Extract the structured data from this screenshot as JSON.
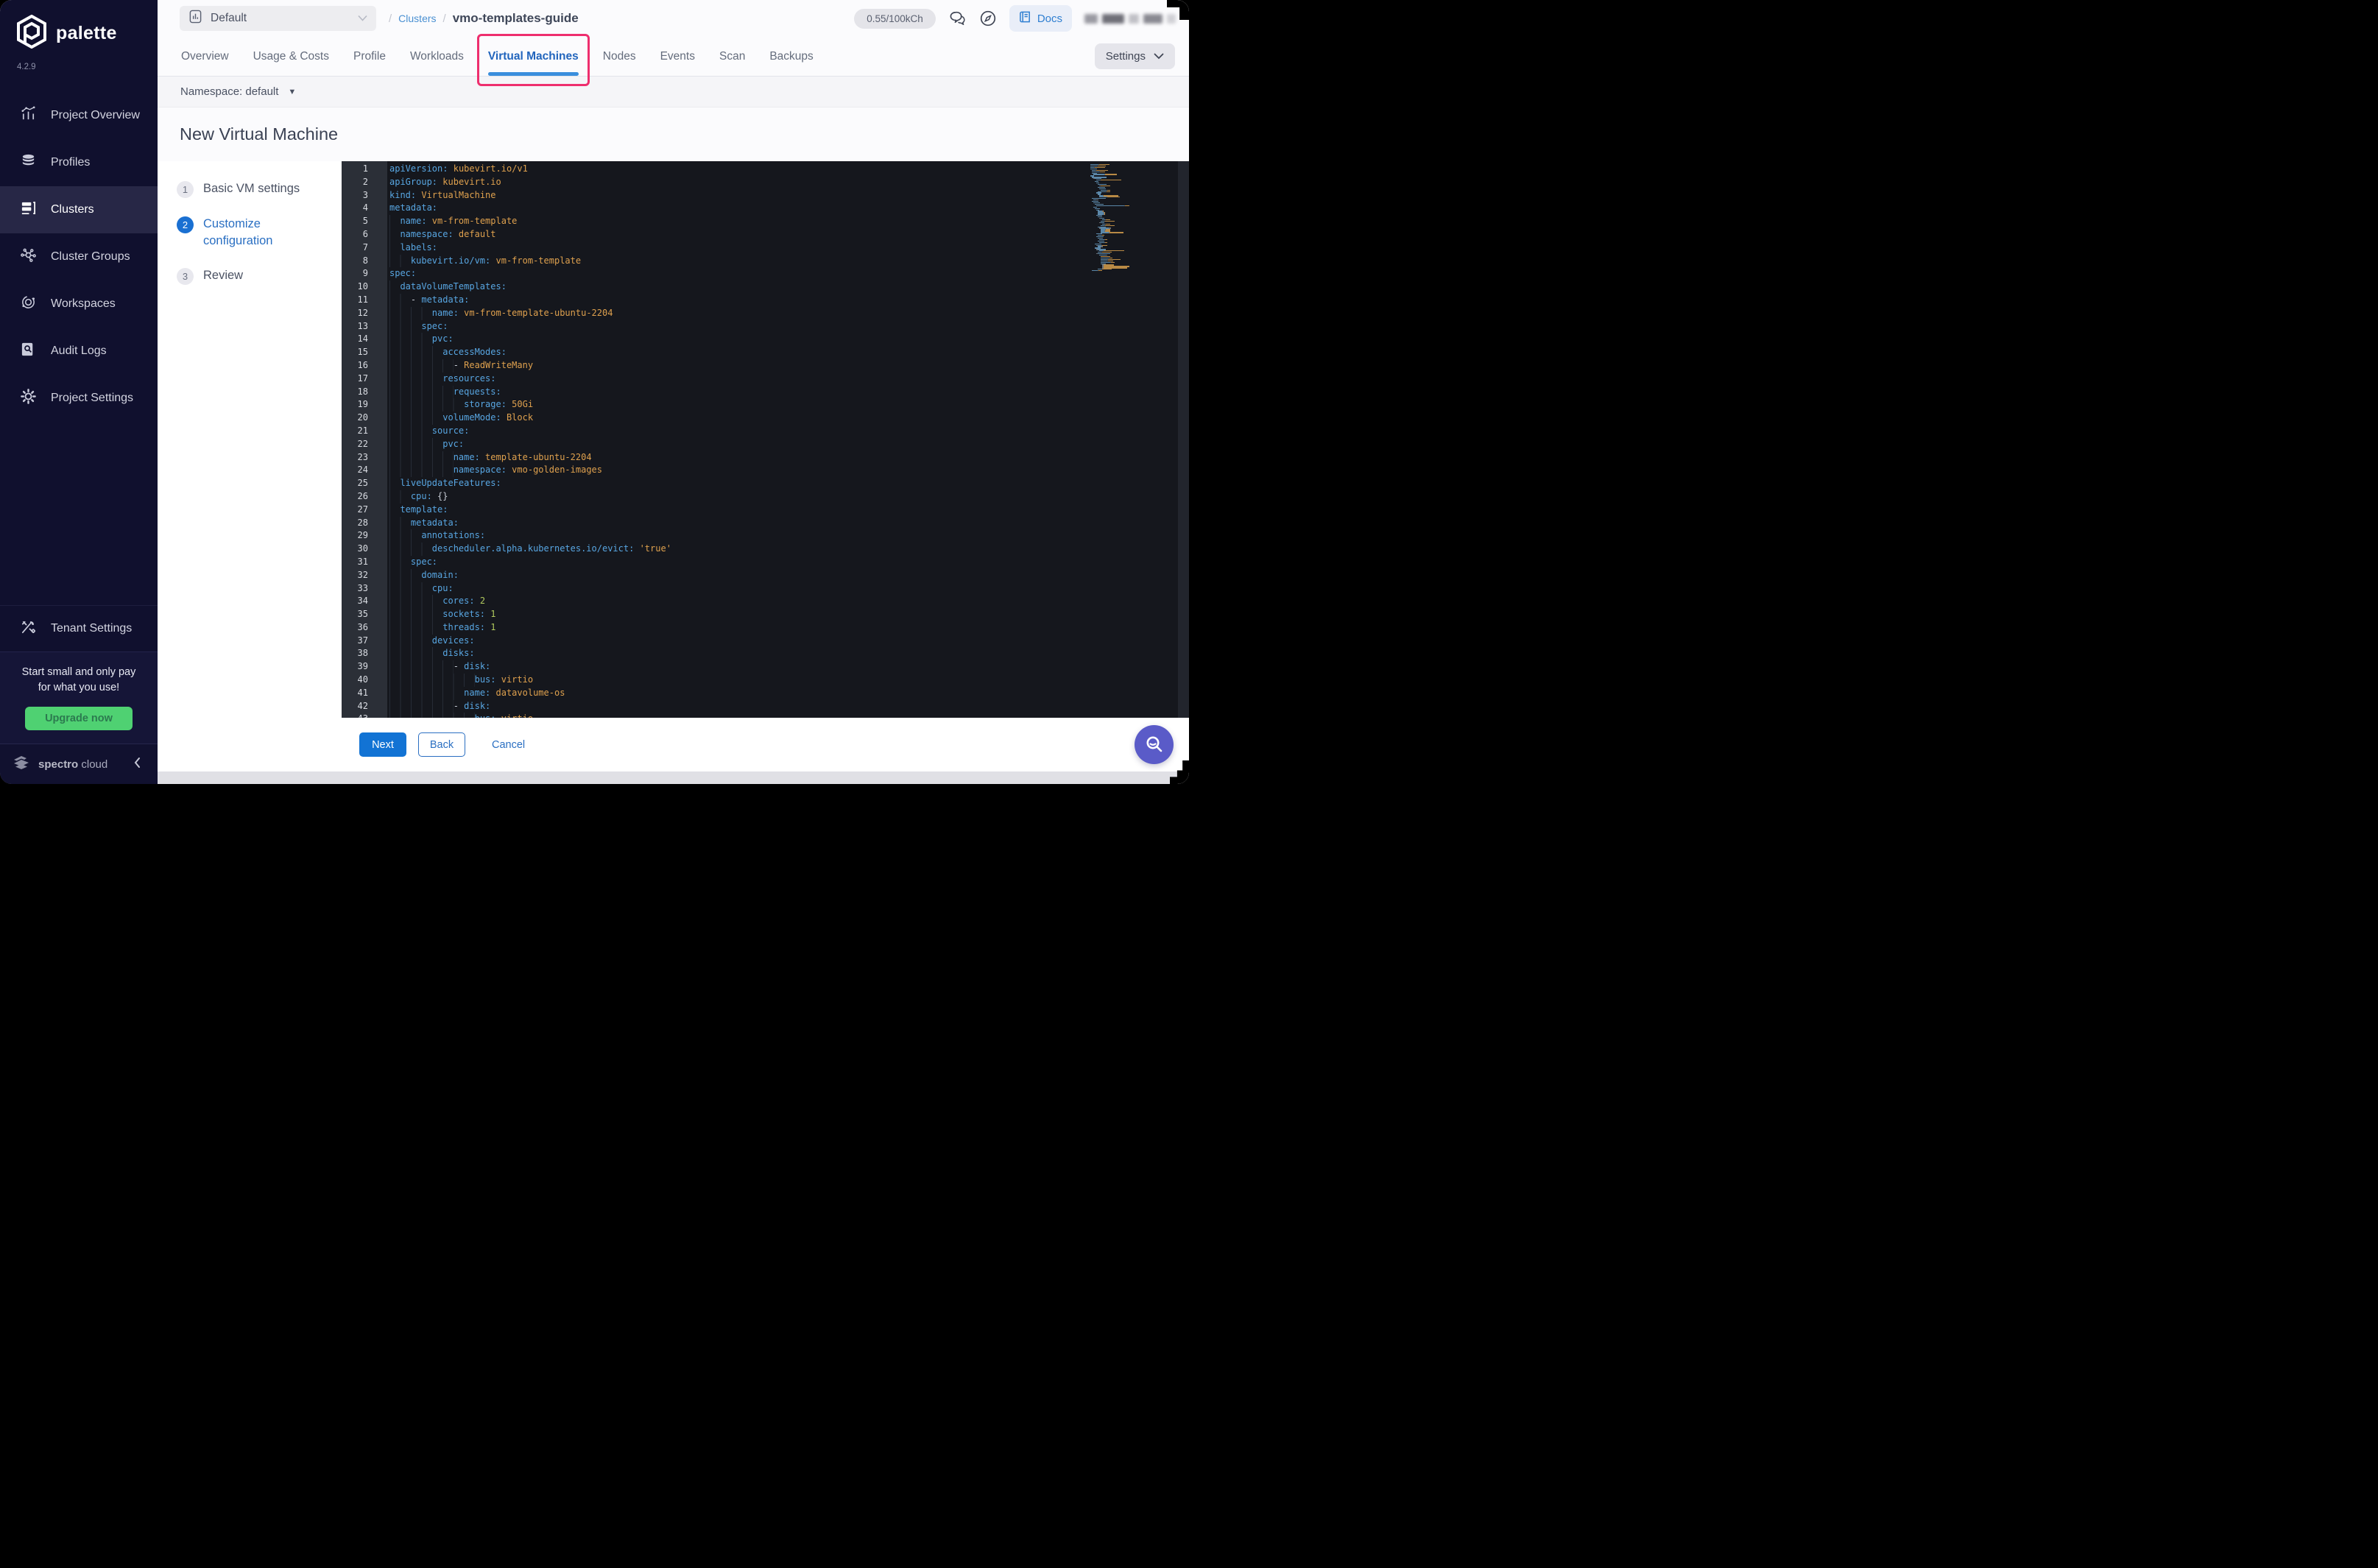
{
  "colors": {
    "pink": "#ee2e6e",
    "blue": "#1273d4",
    "green": "#4fd172",
    "purple": "#5a5bc8",
    "code-key": "#58a6e2",
    "code-val": "#dfa14e",
    "code-num": "#b0c95e"
  },
  "sidebar": {
    "brand": "palette",
    "version": "4.2.9",
    "items": [
      {
        "label": "Project Overview"
      },
      {
        "label": "Profiles"
      },
      {
        "label": "Clusters"
      },
      {
        "label": "Cluster Groups"
      },
      {
        "label": "Workspaces"
      },
      {
        "label": "Audit Logs"
      },
      {
        "label": "Project Settings"
      }
    ],
    "active": "Clusters",
    "tenant_label": "Tenant Settings",
    "upsell": {
      "line1": "Start small and only pay",
      "line2": "for what you use!",
      "button": "Upgrade now"
    },
    "footer": {
      "brand_strong": "spectro",
      "brand_light": "cloud"
    }
  },
  "topbar": {
    "project": "Default",
    "breadcrumb": {
      "separator": "/",
      "section": "Clusters",
      "current": "vmo-templates-guide"
    },
    "usage_pill": "0.55/100kCh",
    "docs_label": "Docs"
  },
  "tabs": {
    "items": [
      "Overview",
      "Usage & Costs",
      "Profile",
      "Workloads",
      "Virtual Machines",
      "Nodes",
      "Events",
      "Scan",
      "Backups"
    ],
    "active": "Virtual Machines",
    "settings_label": "Settings"
  },
  "namespace_bar": {
    "label": "Namespace: default"
  },
  "page": {
    "title": "New Virtual Machine"
  },
  "wizard": {
    "steps": [
      {
        "num": "1",
        "label": "Basic VM settings"
      },
      {
        "num": "2",
        "label": "Customize configuration"
      },
      {
        "num": "3",
        "label": "Review"
      }
    ],
    "active_step": "2"
  },
  "editor": {
    "lines": [
      "apiVersion: kubevirt.io/v1",
      "apiGroup: kubevirt.io",
      "kind: VirtualMachine",
      "metadata:",
      "  name: vm-from-template",
      "  namespace: default",
      "  labels:",
      "    kubevirt.io/vm: vm-from-template",
      "spec:",
      "  dataVolumeTemplates:",
      "    - metadata:",
      "        name: vm-from-template-ubuntu-2204",
      "      spec:",
      "        pvc:",
      "          accessModes:",
      "            - ReadWriteMany",
      "          resources:",
      "            requests:",
      "              storage: 50Gi",
      "          volumeMode: Block",
      "        source:",
      "          pvc:",
      "            name: template-ubuntu-2204",
      "            namespace: vmo-golden-images",
      "  liveUpdateFeatures:",
      "    cpu: {}",
      "  template:",
      "    metadata:",
      "      annotations:",
      "        descheduler.alpha.kubernetes.io/evict: 'true'",
      "    spec:",
      "      domain:",
      "        cpu:",
      "          cores: 2",
      "          sockets: 1",
      "          threads: 1",
      "        devices:",
      "          disks:",
      "            - disk:",
      "                bus: virtio",
      "              name: datavolume-os",
      "            - disk:",
      "                bus: virtio"
    ],
    "minimap_tail": [
      "              name: cloudinitdisk",
      "          interfaces:",
      "            - masquerade: {}",
      "              model: virtio",
      "              name: default",
      "              macAddress: '02:C9:02:28:06:5A'",
      "        machine:",
      "          type: q35",
      "        resources:",
      "          limits:",
      "            memory: 2Gi",
      "          requests:",
      "            memory: 2Gi",
      "      networks:",
      "        - name: default",
      "          pod: {}",
      "      volumes:",
      "        - dataVolume:",
      "            name: vm-from-template-ubuntu-2204",
      "          name: datavolume-os",
      "        - cloudInitNoCloud:",
      "            userData: |",
      "              #cloud-config",
      "              ssh_pwauth: true",
      "              chpasswd: { expire: false }",
      "              password: spectro",
      "              disable_root: false",
      "              runcmd:",
      "                - apt-get update",
      "                - apt-get install -y qemu-guest-agent",
      "                - systemctl start qemu-guest-agent",
      "          name: cloudinitdisk",
      "  running: false"
    ]
  },
  "footer_bar": {
    "next": "Next",
    "back": "Back",
    "cancel": "Cancel"
  }
}
